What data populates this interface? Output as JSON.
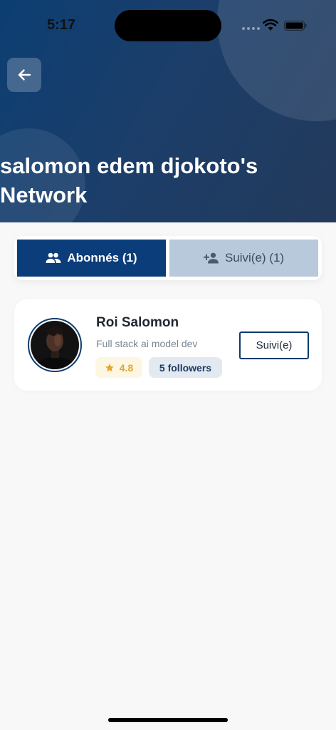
{
  "status_bar": {
    "time": "5:17"
  },
  "header": {
    "title": "salomon edem djokoto's Network",
    "back_icon": "arrow-left-icon"
  },
  "tabs": [
    {
      "label": "Abonnés (1)",
      "icon": "people-icon",
      "active": true
    },
    {
      "label": "Suivi(e) (1)",
      "icon": "person-add-icon",
      "active": false
    }
  ],
  "users": [
    {
      "name": "Roi Salomon",
      "bio": "Full stack ai model dev",
      "rating": "4.8",
      "followers": "5 followers",
      "button_label": "Suivi(e)"
    }
  ],
  "colors": {
    "primary": "#0a3d7a",
    "inactive_tab": "#b7c9db",
    "rating": "#e3a52a",
    "header_gradient_start": "#0c3e73",
    "header_gradient_end": "#233a5b"
  }
}
